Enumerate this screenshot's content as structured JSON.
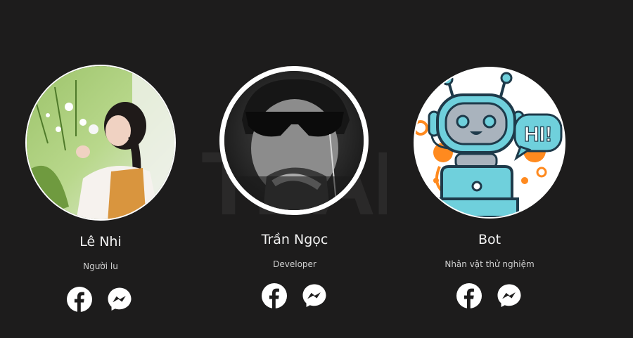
{
  "watermark": "TEAM",
  "members": [
    {
      "name": "Lê Nhi",
      "role": "Người lu",
      "facebook_icon": "facebook-icon",
      "messenger_icon": "messenger-icon"
    },
    {
      "name": "Trần Ngọc",
      "role": "Developer",
      "facebook_icon": "facebook-icon",
      "messenger_icon": "messenger-icon"
    },
    {
      "name": "Bot",
      "role": "Nhân vật thử nghiệm",
      "facebook_icon": "facebook-icon",
      "messenger_icon": "messenger-icon",
      "avatar_speech": "HI!"
    }
  ],
  "colors": {
    "background": "#1d1c1c",
    "avatar_border": "#ffffff",
    "bot_accent": "#ff8a1f",
    "bot_cyan": "#6fd0dc"
  }
}
